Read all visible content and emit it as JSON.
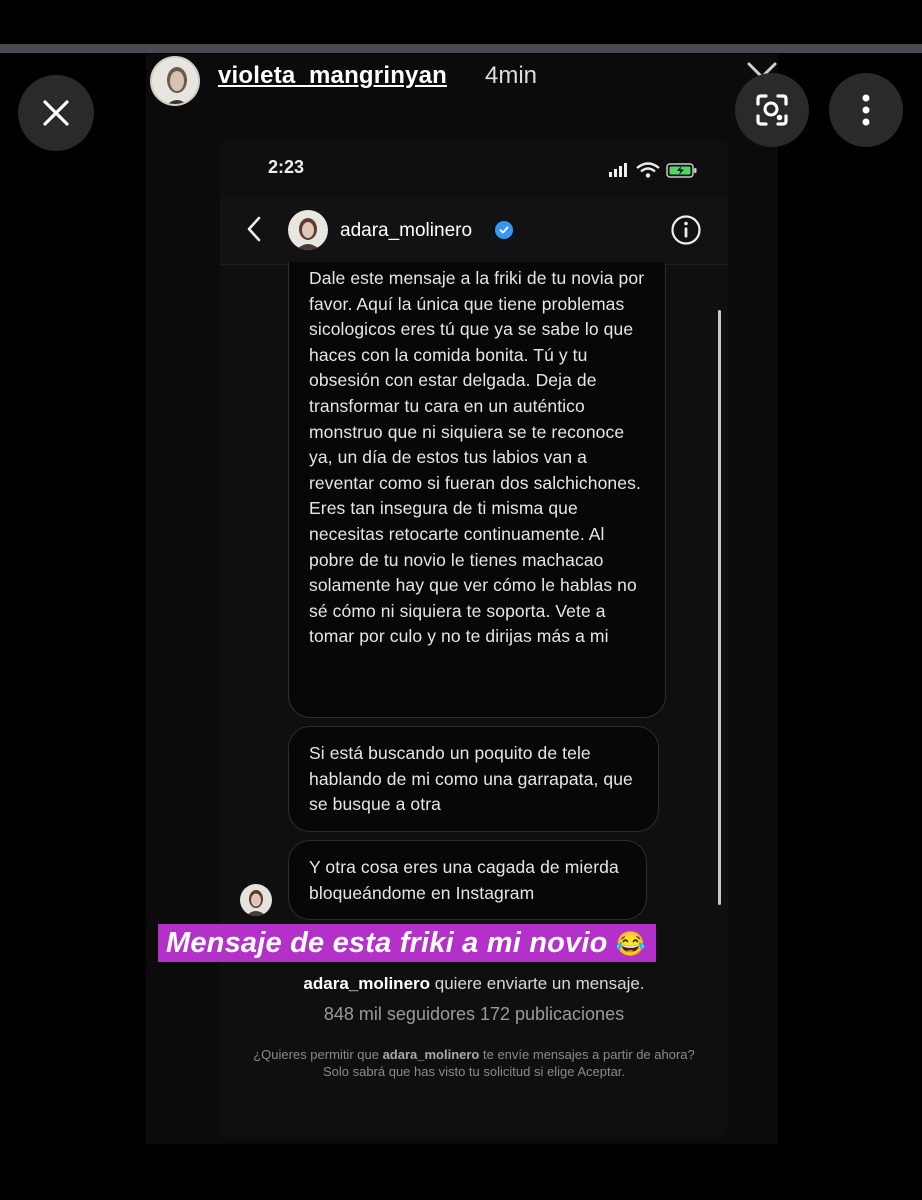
{
  "story": {
    "username": "violeta_mangrinyan",
    "time": "4min"
  },
  "phone": {
    "status_time": "2:23",
    "chat_username": "adara_molinero"
  },
  "messages": [
    "Dale este mensaje a la friki de tu novia por favor. Aquí la única que tiene problemas sicologicos eres tú que ya se sabe lo que haces con la comida bonita. Tú y tu obsesión con estar delgada. Deja de transformar tu cara en un auténtico monstruo que ni siquiera se te reconoce ya, un día de estos tus labios van a reventar como si fueran dos salchichones. Eres tan insegura de ti misma que necesitas retocarte continuamente. Al pobre de tu novio le tienes machacao solamente hay que ver cómo le hablas no sé cómo ni siquiera te soporta. Vete a tomar por culo y no te dirijas más a mi",
    "Si está buscando un poquito de tele hablando de mi como una garrapata, que se busque a otra",
    "Y otra cosa eres una cagada de mierda bloqueándome en Instagram"
  ],
  "caption": {
    "text": "Mensaje de esta friki a mi novio",
    "emoji": "😂"
  },
  "request": {
    "username": "adara_molinero",
    "text": " quiere enviarte un mensaje.",
    "stats": "848 mil seguidores 172 publicaciones",
    "permit_prefix": "¿Quieres permitir que ",
    "permit_username": "adara_molinero",
    "permit_suffix": " te envíe mensajes a partir de ahora? Solo sabrá que has visto tu solicitud si elige Aceptar."
  },
  "colors": {
    "caption_bg": "#b431c9",
    "verified": "#3897f0",
    "battery": "#4cd964"
  }
}
